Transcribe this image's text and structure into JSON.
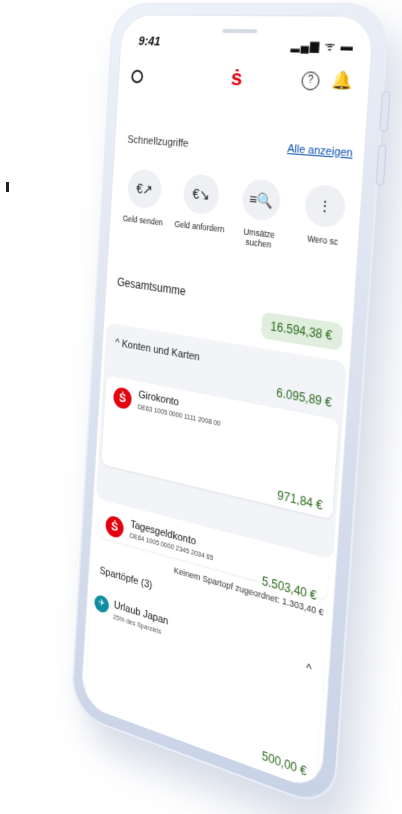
{
  "status": {
    "time": "9:41",
    "icons": "▂▄▆ ᯤ ▬"
  },
  "topbar": {
    "logo": "ṡ",
    "help": "?",
    "bell": "🔔"
  },
  "quick": {
    "title": "Schnellzugriffe",
    "show_all": "Alle anzeigen",
    "items": [
      {
        "label": "Geld senden",
        "icon": "€↗"
      },
      {
        "label": "Geld anfordern",
        "icon": "€↘"
      },
      {
        "label": "Umsätze suchen",
        "icon": "≡🔍"
      },
      {
        "label": "Wero sc",
        "icon": "⋮"
      }
    ]
  },
  "total": {
    "label": "Gesamtsumme",
    "value": "16.594,38 €"
  },
  "accounts": {
    "header": "Konten und Karten",
    "header_chevron": "^",
    "sum": "6.095,89 €",
    "items": [
      {
        "name": "Girokonto",
        "iban": "DE63 1005 0000 1111 2008 00",
        "amount": "971,84 €",
        "logo": "Ṡ"
      },
      {
        "name": "Tagesgeldkonto",
        "iban": "DE64 1005 0000 2345 2034 65",
        "amount": "5.503,40 €",
        "logo": "Ṡ"
      }
    ]
  },
  "unassigned": "Keinem Spartopf zugeordnet: 1.303,40 €",
  "pots": {
    "title": "Spartöpfe (3)",
    "items": [
      {
        "name": "Urlaub Japan",
        "progress": "25% des Sparziels",
        "amount": "500,00 €",
        "chevron": "^"
      }
    ]
  }
}
